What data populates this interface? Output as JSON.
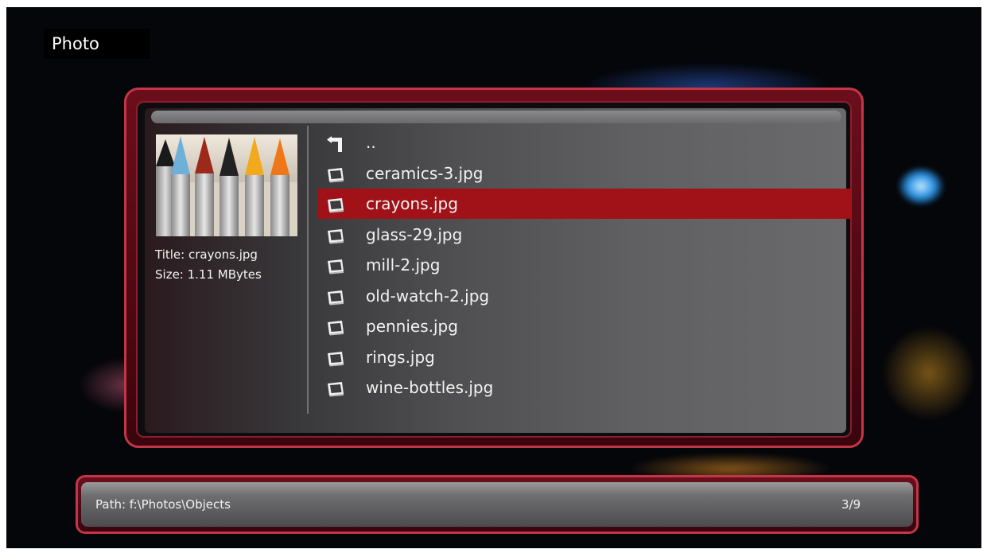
{
  "header": {
    "title": "Photo"
  },
  "preview": {
    "title_text": "Title: crayons.jpg",
    "size_text": "Size: 1.11 MBytes"
  },
  "file_list": {
    "items": [
      {
        "label": "..",
        "icon": "back-arrow-icon"
      },
      {
        "label": "ceramics-3.jpg",
        "icon": "photo-file-icon"
      },
      {
        "label": "crayons.jpg",
        "icon": "photo-file-icon",
        "selected": true
      },
      {
        "label": "glass-29.jpg",
        "icon": "photo-file-icon"
      },
      {
        "label": "mill-2.jpg",
        "icon": "photo-file-icon"
      },
      {
        "label": "old-watch-2.jpg",
        "icon": "photo-file-icon"
      },
      {
        "label": "pennies.jpg",
        "icon": "photo-file-icon"
      },
      {
        "label": "rings.jpg",
        "icon": "photo-file-icon"
      },
      {
        "label": "wine-bottles.jpg",
        "icon": "photo-file-icon"
      }
    ]
  },
  "status": {
    "path": "Path: f:\\Photos\\Objects",
    "counter": "3/9"
  },
  "colors": {
    "frame": "#c23648",
    "selection": "#a01218",
    "background": "#05060a"
  }
}
